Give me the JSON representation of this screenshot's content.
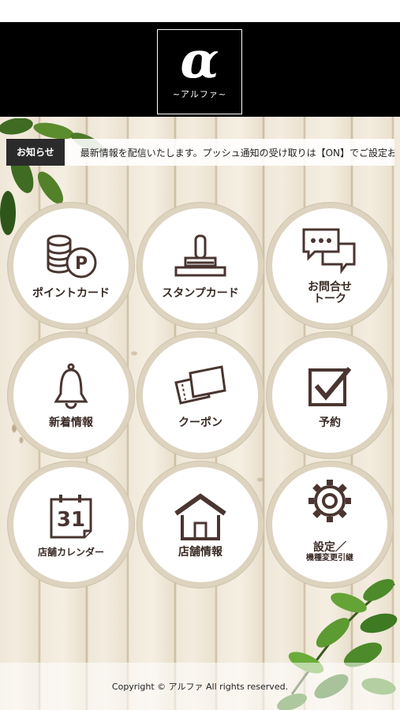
{
  "header": {
    "logo_glyph": "α",
    "logo_sub": "~アルファ~"
  },
  "news": {
    "label": "お知らせ",
    "text": "最新情報を配信いたします。プッシュ通知の受け取りは【ON】でご設定お願いします。"
  },
  "menu": [
    {
      "label": "ポイントカード",
      "icon": "point-coins-icon"
    },
    {
      "label": "スタンプカード",
      "icon": "stamp-icon"
    },
    {
      "label": "お問合せ\nトーク",
      "icon": "chat-bubbles-icon"
    },
    {
      "label": "新着情報",
      "icon": "bell-icon"
    },
    {
      "label": "クーポン",
      "icon": "coupon-ticket-icon"
    },
    {
      "label": "予約",
      "icon": "checkbox-icon"
    },
    {
      "label": "店舗カレンダー",
      "icon": "calendar-icon",
      "calendar_day": "31"
    },
    {
      "label": "店舗情報",
      "icon": "house-icon"
    },
    {
      "label": "設定／",
      "sub": "機種変更引継",
      "icon": "gear-icon"
    }
  ],
  "footer": {
    "copyright": "Copyright © アルファ All rights reserved."
  },
  "colors": {
    "header_bg": "#000000",
    "icon_brown": "#4a3530",
    "ring": "#ddd3bf"
  }
}
